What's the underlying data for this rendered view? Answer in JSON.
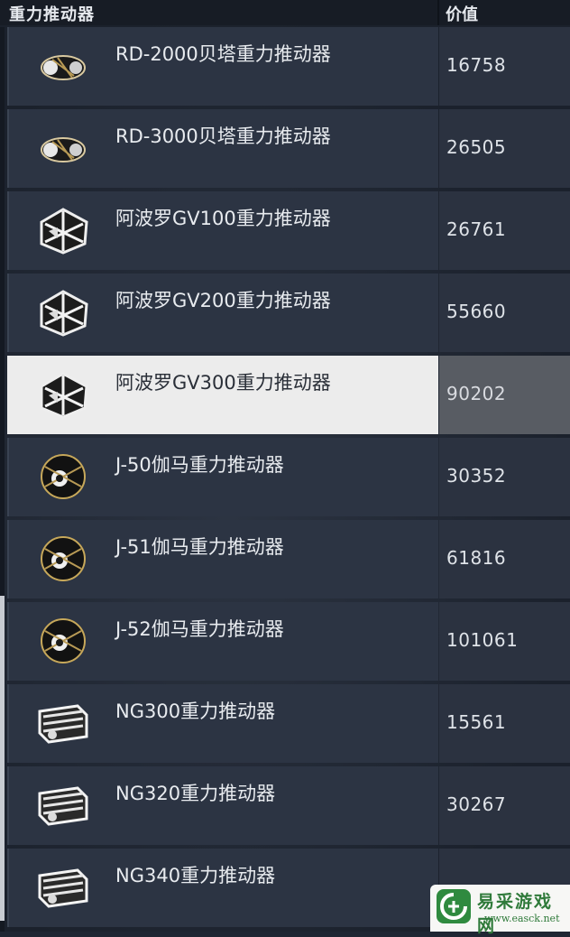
{
  "header": {
    "name_column": "重力推动器",
    "value_column": "价值"
  },
  "rows": [
    {
      "name": "RD-2000贝塔重力推动器",
      "value": "16758",
      "icon": "rd-thruster-icon",
      "selected": false
    },
    {
      "name": "RD-3000贝塔重力推动器",
      "value": "26505",
      "icon": "rd-thruster-icon",
      "selected": false
    },
    {
      "name": "阿波罗GV100重力推动器",
      "value": "26761",
      "icon": "apollo-thruster-icon",
      "selected": false
    },
    {
      "name": "阿波罗GV200重力推动器",
      "value": "55660",
      "icon": "apollo-thruster-icon",
      "selected": false
    },
    {
      "name": "阿波罗GV300重力推动器",
      "value": "90202",
      "icon": "apollo-thruster-icon",
      "selected": true
    },
    {
      "name": "J-50伽马重力推动器",
      "value": "30352",
      "icon": "gamma-thruster-icon",
      "selected": false
    },
    {
      "name": "J-51伽马重力推动器",
      "value": "61816",
      "icon": "gamma-thruster-icon",
      "selected": false
    },
    {
      "name": "J-52伽马重力推动器",
      "value": "101061",
      "icon": "gamma-thruster-icon",
      "selected": false
    },
    {
      "name": "NG300重力推动器",
      "value": "15561",
      "icon": "ng-thruster-icon",
      "selected": false
    },
    {
      "name": "NG320重力推动器",
      "value": "30267",
      "icon": "ng-thruster-icon",
      "selected": false
    },
    {
      "name": "NG340重力推动器",
      "value": "",
      "icon": "ng-thruster-icon",
      "selected": false
    }
  ],
  "watermark": {
    "text": "易采游戏网",
    "url": "www.easck.net",
    "color": "#2f7a3a"
  }
}
